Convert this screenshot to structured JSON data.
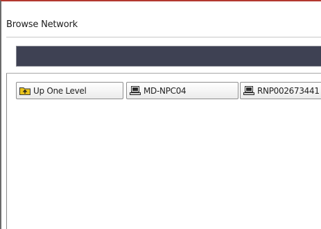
{
  "window": {
    "title": "Browse Network"
  },
  "path_bar": {
    "value": ""
  },
  "buttons": {
    "up_one_level": {
      "label": "Up One Level",
      "icon": "folder-up-icon"
    },
    "computers": [
      {
        "label": "MD-NPC04",
        "icon": "computer-icon"
      },
      {
        "label": "RNP002673441",
        "icon": "computer-icon"
      }
    ]
  },
  "colors": {
    "path_bar": "#3e4153",
    "folder_icon": "#e8c21c",
    "window_top_border": "#b3382f"
  }
}
